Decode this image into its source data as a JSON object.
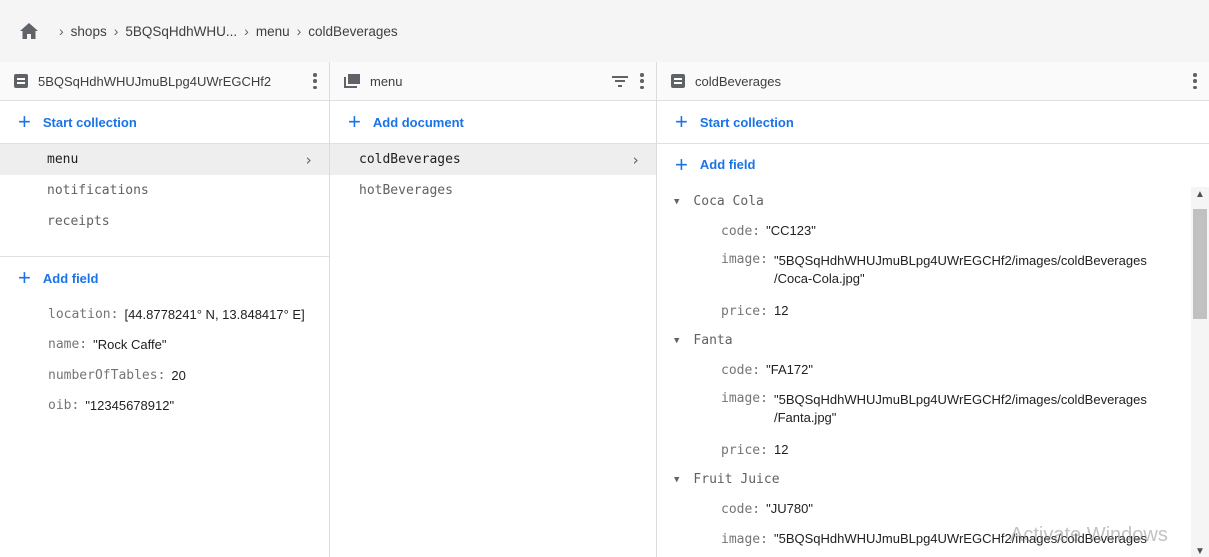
{
  "breadcrumb": [
    "shops",
    "5BQSqHdhWHU...",
    "menu",
    "coldBeverages"
  ],
  "panel1": {
    "title": "5BQSqHdhWHUJmuBLpg4UWrEGCHf2",
    "start_collection": "Start collection",
    "collections": [
      "menu",
      "notifications",
      "receipts"
    ],
    "add_field": "Add field",
    "fields": [
      {
        "key": "location:",
        "value": "[44.8778241° N, 13.848417° E]"
      },
      {
        "key": "name:",
        "value": "\"Rock Caffe\""
      },
      {
        "key": "numberOfTables:",
        "value": "20"
      },
      {
        "key": "oib:",
        "value": "\"12345678912\""
      }
    ]
  },
  "panel2": {
    "title": "menu",
    "add_document": "Add document",
    "documents": [
      "coldBeverages",
      "hotBeverages"
    ]
  },
  "panel3": {
    "title": "coldBeverages",
    "start_collection": "Start collection",
    "add_field": "Add field",
    "maps": [
      {
        "name": "Coca Cola",
        "code": "\"CC123\"",
        "image": "\"5BQSqHdhWHUJmuBLpg4UWrEGCHf2/images/coldBeverages",
        "image2": "/Coca-Cola.jpg\"",
        "price": "12"
      },
      {
        "name": "Fanta",
        "code": "\"FA172\"",
        "image": "\"5BQSqHdhWHUJmuBLpg4UWrEGCHf2/images/coldBeverages",
        "image2": "/Fanta.jpg\"",
        "price": "12"
      },
      {
        "name": "Fruit Juice",
        "code": "\"JU780\"",
        "image": "\"5BQSqHdhWHUJmuBLpg4UWrEGCHf2/images/coldBeverages",
        "image2": "",
        "price": ""
      }
    ],
    "labels": {
      "code": "code:",
      "image": "image:",
      "price": "price:"
    }
  },
  "watermark": "Activate Windows",
  "colors": {
    "accent": "#1a73e8",
    "selected": "#eeeeee",
    "breadcrumb_bg": "#f5f5f5"
  }
}
